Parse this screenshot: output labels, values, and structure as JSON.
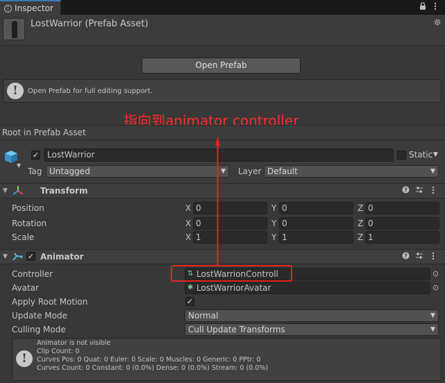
{
  "window": {
    "tab_title": "Inspector"
  },
  "header": {
    "asset_title": "LostWarrior (Prefab Asset)"
  },
  "prefab": {
    "open_button": "Open Prefab",
    "help_text": "Open Prefab for full editing support."
  },
  "annotation": {
    "text": "指向到animator controller",
    "color": "#ff2a2a"
  },
  "root": {
    "label": "Root in Prefab Asset"
  },
  "gameobject": {
    "name": "LostWarrior",
    "static_label": "Static",
    "tag_label": "Tag",
    "tag_value": "Untagged",
    "layer_label": "Layer",
    "layer_value": "Default"
  },
  "transform": {
    "title": "Transform",
    "rows": [
      {
        "label": "Position",
        "x": "0",
        "y": "0",
        "z": "0"
      },
      {
        "label": "Rotation",
        "x": "0",
        "y": "0",
        "z": "0"
      },
      {
        "label": "Scale",
        "x": "1",
        "y": "1",
        "z": "1"
      }
    ],
    "axis_x": "X",
    "axis_y": "Y",
    "axis_z": "Z"
  },
  "animator": {
    "title": "Animator",
    "controller_label": "Controller",
    "controller_value": "LostWarrionControll",
    "avatar_label": "Avatar",
    "avatar_value": "LostWarriorAvatar",
    "apply_root_motion_label": "Apply Root Motion",
    "update_mode_label": "Update Mode",
    "update_mode_value": "Normal",
    "culling_mode_label": "Culling Mode",
    "culling_mode_value": "Cull Update Transforms",
    "info_lines": [
      "Animator is not visible",
      "Clip Count: 0",
      "Curves Pos: 0 Quat: 0 Euler: 0 Scale: 0 Muscles: 0 Generic: 0 PPtr: 0",
      "Curves Count: 0 Constant: 0 (0.0%) Dense: 0 (0.0%) Stream: 0 (0.0%)"
    ]
  },
  "icons": {
    "lock": "lock-icon",
    "menu": "menu-icon",
    "gear": "gear-icon",
    "help": "help-icon",
    "presets": "presets-icon",
    "more": "more-icon",
    "info": "info-icon",
    "cube": "cube-icon",
    "transform": "transform-icon",
    "animator": "animator-icon"
  },
  "colors": {
    "accent": "#3a79bb",
    "highlight_box": "#e8231e"
  }
}
